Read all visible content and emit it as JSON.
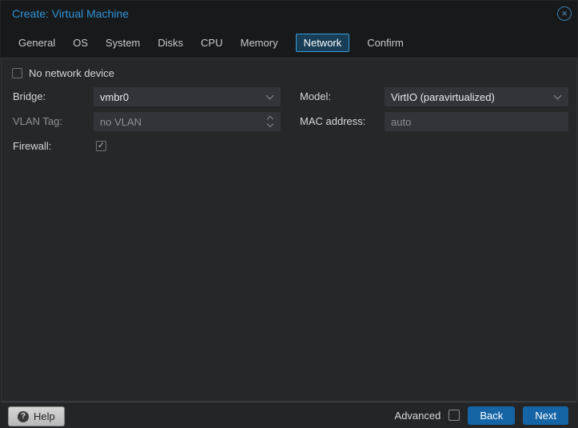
{
  "window": {
    "title": "Create: Virtual Machine"
  },
  "icons": {
    "close": "×",
    "help": "?",
    "check": "✓"
  },
  "tabs": [
    {
      "label": "General",
      "active": false
    },
    {
      "label": "OS",
      "active": false
    },
    {
      "label": "System",
      "active": false
    },
    {
      "label": "Disks",
      "active": false
    },
    {
      "label": "CPU",
      "active": false
    },
    {
      "label": "Memory",
      "active": false
    },
    {
      "label": "Network",
      "active": true
    },
    {
      "label": "Confirm",
      "active": false
    }
  ],
  "form": {
    "no_network_device": {
      "label": "No network device",
      "checked": false
    },
    "bridge": {
      "label": "Bridge:",
      "value": "vmbr0"
    },
    "model": {
      "label": "Model:",
      "value": "VirtIO (paravirtualized)"
    },
    "vlan_tag": {
      "label": "VLAN Tag:",
      "placeholder": "no VLAN",
      "disabled": true
    },
    "mac_address": {
      "label": "MAC address:",
      "placeholder": "auto"
    },
    "firewall": {
      "label": "Firewall:",
      "checked": true
    }
  },
  "footer": {
    "help": "Help",
    "advanced": "Advanced",
    "advanced_checked": false,
    "back": "Back",
    "next": "Next"
  },
  "colors": {
    "accent_blue": "#3094d8",
    "active_tab_border": "#3c9cd7",
    "active_tab_bg": "#173d57",
    "button_blue": "#1565a6",
    "header_bg": "#17191a",
    "panel_bg": "#262729",
    "field_bg": "#313438"
  }
}
